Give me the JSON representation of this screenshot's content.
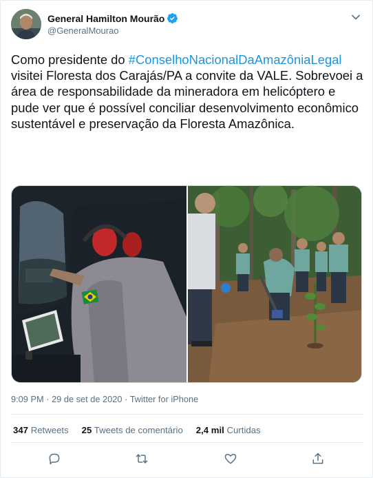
{
  "author": {
    "name": "General Hamilton Mourão",
    "handle": "@GeneralMourao",
    "verified": true
  },
  "tweet": {
    "text_before": "Como presidente do ",
    "hashtag": "#ConselhoNacionalDaAmazôniaLegal",
    "text_after": " visitei Floresta dos Carajás/PA a convite da VALE. Sobrevoei a área de responsabilidade da mineradora em helicóptero e pude ver que é possível conciliar desenvolvimento econômico sustentável e preservação da Floresta Amazônica."
  },
  "media": {
    "photos": [
      "helicopter-photo",
      "tree-planting-photo"
    ]
  },
  "meta": {
    "time": "9:09 PM",
    "separator": "·",
    "date": "29 de set de 2020",
    "source": "Twitter for iPhone"
  },
  "stats": {
    "retweets_count": "347",
    "retweets_label": "Retweets",
    "comments_count": "25",
    "comments_label": "Tweets de comentário",
    "likes_count": "2,4 mil",
    "likes_label": "Curtidas"
  },
  "actions": [
    "reply-icon",
    "retweet-icon",
    "like-icon",
    "share-icon"
  ],
  "colors": {
    "accent": "#1b95e0",
    "verified": "#1da1f2",
    "secondary_text": "#5b7083",
    "border": "#e6ecf0"
  }
}
